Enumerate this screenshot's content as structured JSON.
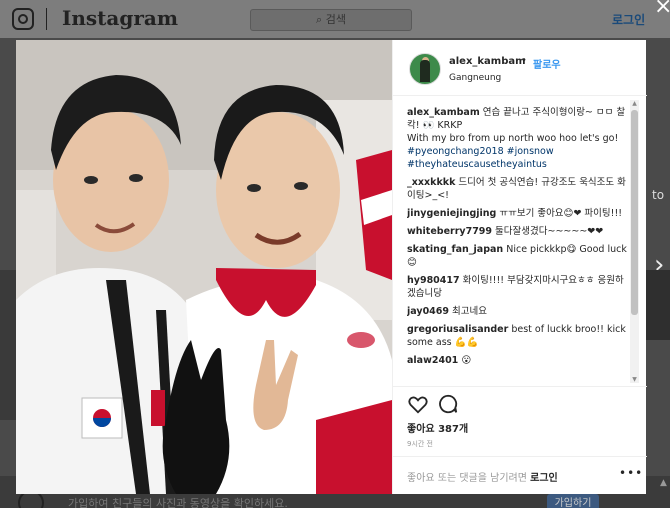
{
  "header": {
    "wordmark": "Instagram",
    "search_placeholder": "검색",
    "login_label": "로그인"
  },
  "background": {
    "side_text": "to",
    "bottom_text": "가입하여 친구들의 사진과 동영상을 확인하세요.",
    "bottom_button": "가입하기"
  },
  "post": {
    "username": "alex_kambam",
    "dot": "•",
    "follow_label": "팔로우",
    "location": "Gangneung",
    "comments": [
      {
        "user": "alex_kambam",
        "text": " 연습 끝나고 주식이형이랑~ ㅁㅁ 찰칵! 👀 KRKP\nWith my bro from up north woo hoo let's go! ",
        "tags": "#pyeongchang2018 #jonsnow #theyhateuscausetheyaintus"
      },
      {
        "user": "_xxxkkkk",
        "text": " 드디어 첫 공식연습! 규강조도 욱식조도 화이팅>_<!",
        "tags": ""
      },
      {
        "user": "jinygeniejingjing",
        "text": " ㅠㅠ보기 좋아요😊❤ 파이팅!!!",
        "tags": ""
      },
      {
        "user": "whiteberry7799",
        "text": " 둘다잘생겼다~~~~~❤❤",
        "tags": ""
      },
      {
        "user": "skating_fan_japan",
        "text": " Nice pickkkp😋 Good luck😊",
        "tags": ""
      },
      {
        "user": "hy980417",
        "text": " 화이팅!!!! 부담갖지마시구요ㅎㅎ 응원하겠습니당",
        "tags": ""
      },
      {
        "user": "jay0469",
        "text": " 최고네요",
        "tags": ""
      },
      {
        "user": "gregoriusalisander",
        "text": " best of luckk broo!! kick some ass 💪💪",
        "tags": ""
      },
      {
        "user": "alaw2401",
        "text": " 😮",
        "tags": ""
      }
    ],
    "likes": "좋아요 387개",
    "time": "9시간 전",
    "add_comment_prefix": "좋아요 또는 댓글을 남기려면 ",
    "add_comment_login": "로그인",
    "more_label": "•••"
  },
  "controls": {
    "close_label": "×",
    "next_arrow": "›"
  },
  "colors": {
    "accent": "#3897f0",
    "text": "#262626",
    "muted": "#999999"
  }
}
